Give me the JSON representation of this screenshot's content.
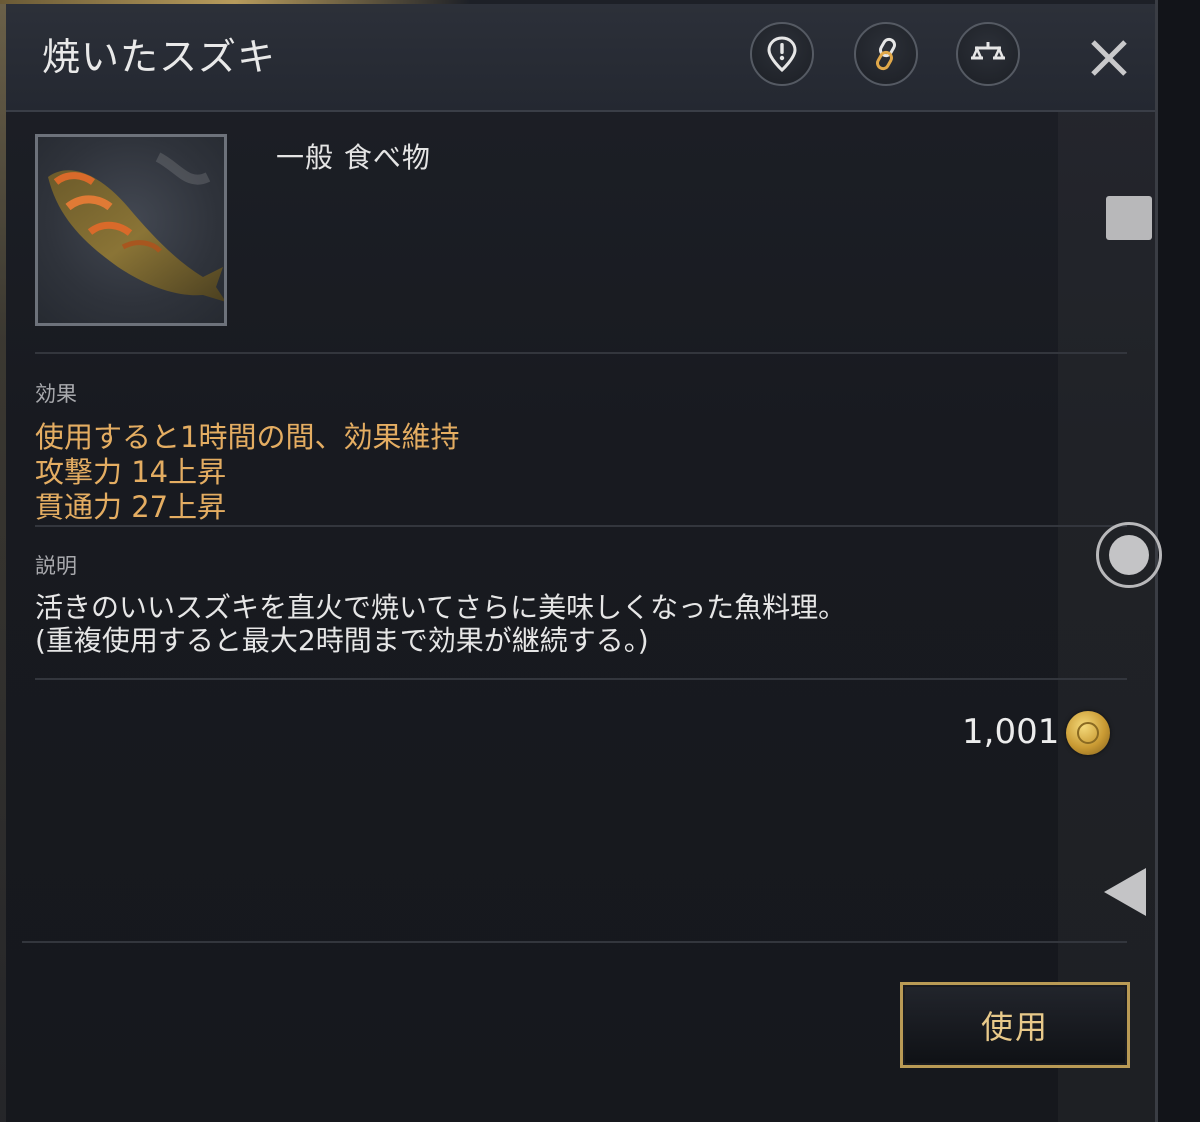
{
  "header": {
    "title": "焼いたスズキ",
    "buttons": [
      {
        "icon": "alert-pin-icon"
      },
      {
        "icon": "link-icon"
      },
      {
        "icon": "scale-icon"
      },
      {
        "icon": "close-icon"
      }
    ]
  },
  "item": {
    "category": "一般  食べ物",
    "image_icon": "grilled-fish-icon"
  },
  "effects": {
    "label": "効果",
    "lines": [
      "使用すると1時間の間、効果維持",
      "攻撃力  14上昇",
      "貫通力  27上昇"
    ]
  },
  "description": {
    "label": "説明",
    "lines": [
      "活きのいいスズキを直火で焼いてさらに美味しくなった魚料理。",
      "(重複使用すると最大2時間まで効果が継続する。)"
    ]
  },
  "price": {
    "value": "1,001",
    "icon": "gold-coin-icon"
  },
  "use_button": {
    "label": "使用"
  },
  "colors": {
    "effect_text": "#e4ad62",
    "button_border": "#b99a55",
    "background": "#181a20"
  }
}
